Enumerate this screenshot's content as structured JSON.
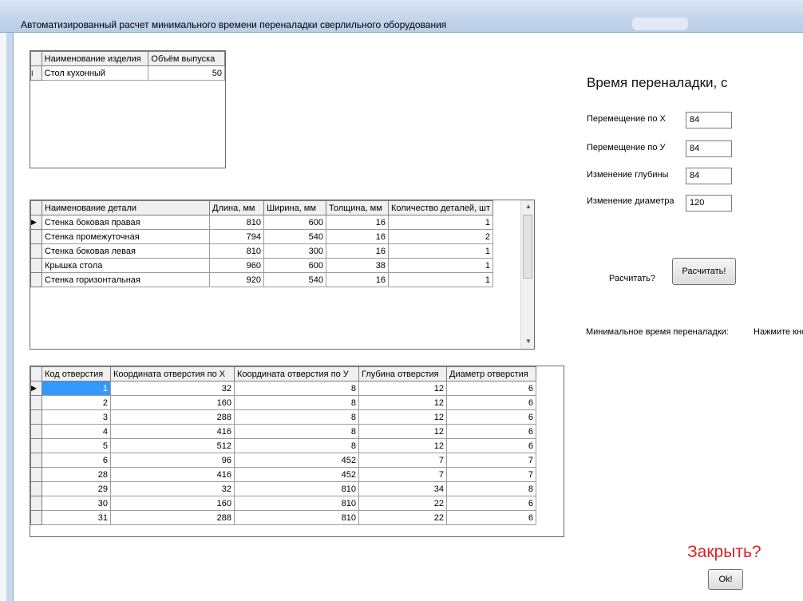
{
  "window": {
    "title": "Автоматизированный расчет минимального времени переналадки сверлильного оборудования"
  },
  "products_grid": {
    "columns": [
      "Наименование изделия",
      "Объём выпуска"
    ],
    "rows": [
      {
        "indicator": "I",
        "cells": [
          "Стол кухонный",
          "50"
        ]
      }
    ]
  },
  "details_grid": {
    "columns": [
      "Наименование детали",
      "Длина, мм",
      "Ширина, мм",
      "Толщина, мм",
      "Количество деталей, шт"
    ],
    "rows": [
      {
        "indicator": "▶",
        "cells": [
          "Стенка боковая правая",
          "810",
          "600",
          "16",
          "1"
        ]
      },
      {
        "indicator": "",
        "cells": [
          "Стенка промежуточная",
          "794",
          "540",
          "16",
          "2"
        ]
      },
      {
        "indicator": "",
        "cells": [
          "Стенка боковая левая",
          "810",
          "300",
          "16",
          "1"
        ]
      },
      {
        "indicator": "",
        "cells": [
          "Крышка стола",
          "960",
          "600",
          "38",
          "1"
        ]
      },
      {
        "indicator": "",
        "cells": [
          "Стенка горизонтальная",
          "920",
          "540",
          "16",
          "1"
        ]
      }
    ]
  },
  "holes_grid": {
    "columns": [
      "Код отверстия",
      "Координата отверстия по X",
      "Координата отверстия по У",
      "Глубина отверстия",
      "Диаметр отверстия"
    ],
    "rows": [
      {
        "indicator": "▶",
        "cells": [
          "1",
          "32",
          "8",
          "12",
          "6"
        ]
      },
      {
        "indicator": "",
        "cells": [
          "2",
          "160",
          "8",
          "12",
          "6"
        ]
      },
      {
        "indicator": "",
        "cells": [
          "3",
          "288",
          "8",
          "12",
          "6"
        ]
      },
      {
        "indicator": "",
        "cells": [
          "4",
          "416",
          "8",
          "12",
          "6"
        ]
      },
      {
        "indicator": "",
        "cells": [
          "5",
          "512",
          "8",
          "12",
          "6"
        ]
      },
      {
        "indicator": "",
        "cells": [
          "6",
          "96",
          "452",
          "7",
          "7"
        ]
      },
      {
        "indicator": "",
        "cells": [
          "28",
          "416",
          "452",
          "7",
          "7"
        ]
      },
      {
        "indicator": "",
        "cells": [
          "29",
          "32",
          "810",
          "34",
          "8"
        ]
      },
      {
        "indicator": "",
        "cells": [
          "30",
          "160",
          "810",
          "22",
          "6"
        ]
      },
      {
        "indicator": "",
        "cells": [
          "31",
          "288",
          "810",
          "22",
          "6"
        ]
      }
    ]
  },
  "changeover": {
    "heading": "Время переналадки, с",
    "fields": [
      {
        "label": "Перемещение по X",
        "value": "84"
      },
      {
        "label": "Перемещение по У",
        "value": "84"
      },
      {
        "label": "Изменение глубины",
        "value": "84"
      },
      {
        "label": "Изменение диаметра",
        "value": "120"
      }
    ]
  },
  "calculate": {
    "question": "Расчитать?",
    "button_label": "Расчитать!"
  },
  "result": {
    "label": "Минимальное время переналадки:",
    "hint": "Нажмите кнопку"
  },
  "close": {
    "question": "Закрыть?",
    "button_label": "Ok!"
  }
}
